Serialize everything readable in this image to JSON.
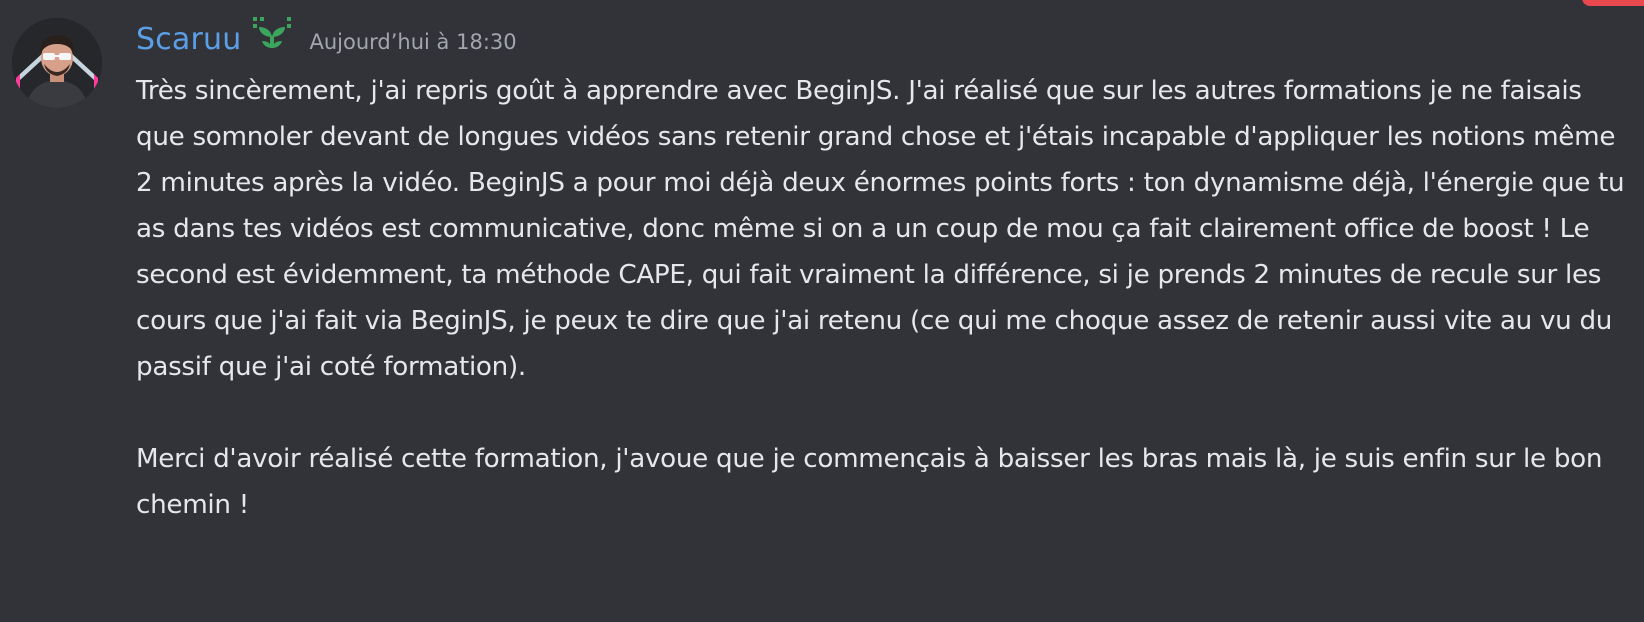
{
  "message": {
    "author": {
      "name": "Scaruu",
      "badge_icon": "sprout-icon",
      "name_color": "#5b9fe6"
    },
    "timestamp": "Aujourd’hui à 18:30",
    "paragraphs": [
      "Très sincèrement, j'ai repris goût à apprendre avec BeginJS. J'ai réalisé que sur les autres formations je ne faisais que somnoler devant de longues vidéos sans retenir grand chose et j'étais incapable d'appliquer les notions même 2 minutes après la vidéo. BeginJS a pour moi déjà deux énormes points forts : ton dynamisme déjà, l'énergie que tu as dans tes vidéos est communicative, donc même si on a un coup de mou ça fait clairement office de boost ! Le second est évidemment, ta méthode CAPE, qui fait vraiment la différence, si je prends 2 minutes de recule sur les cours que j'ai fait via BeginJS, je peux te dire que j'ai retenu (ce qui me choque assez de retenir aussi vite au vu du passif que j'ai coté formation).",
      "Merci d'avoir réalisé cette formation, j'avoue que je commençais à baisser les bras mais là, je suis enfin sur le bon chemin !"
    ]
  },
  "colors": {
    "background": "#313338",
    "text": "#e6e7ea",
    "muted": "#a3a6ad",
    "badge": "#3ba55d",
    "corner": "#e8484e"
  }
}
